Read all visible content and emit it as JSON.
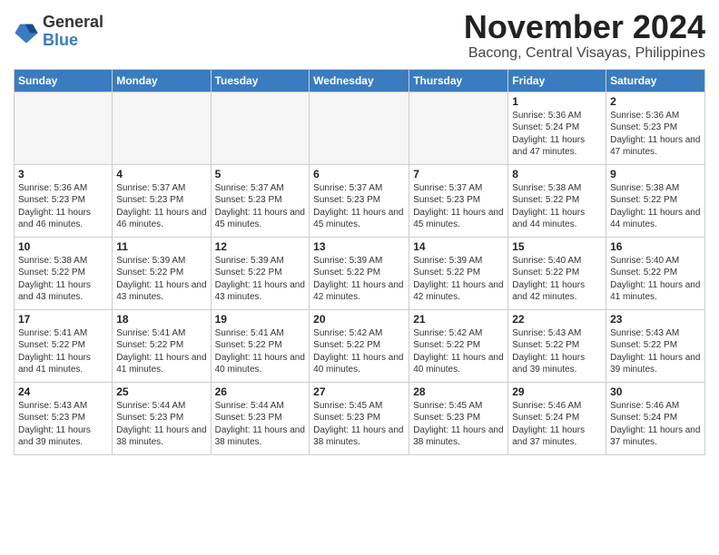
{
  "header": {
    "logo_line1": "General",
    "logo_line2": "Blue",
    "month": "November 2024",
    "location": "Bacong, Central Visayas, Philippines"
  },
  "weekdays": [
    "Sunday",
    "Monday",
    "Tuesday",
    "Wednesday",
    "Thursday",
    "Friday",
    "Saturday"
  ],
  "weeks": [
    [
      {
        "day": "",
        "info": ""
      },
      {
        "day": "",
        "info": ""
      },
      {
        "day": "",
        "info": ""
      },
      {
        "day": "",
        "info": ""
      },
      {
        "day": "",
        "info": ""
      },
      {
        "day": "1",
        "info": "Sunrise: 5:36 AM\nSunset: 5:24 PM\nDaylight: 11 hours and 47 minutes."
      },
      {
        "day": "2",
        "info": "Sunrise: 5:36 AM\nSunset: 5:23 PM\nDaylight: 11 hours and 47 minutes."
      }
    ],
    [
      {
        "day": "3",
        "info": "Sunrise: 5:36 AM\nSunset: 5:23 PM\nDaylight: 11 hours and 46 minutes."
      },
      {
        "day": "4",
        "info": "Sunrise: 5:37 AM\nSunset: 5:23 PM\nDaylight: 11 hours and 46 minutes."
      },
      {
        "day": "5",
        "info": "Sunrise: 5:37 AM\nSunset: 5:23 PM\nDaylight: 11 hours and 45 minutes."
      },
      {
        "day": "6",
        "info": "Sunrise: 5:37 AM\nSunset: 5:23 PM\nDaylight: 11 hours and 45 minutes."
      },
      {
        "day": "7",
        "info": "Sunrise: 5:37 AM\nSunset: 5:23 PM\nDaylight: 11 hours and 45 minutes."
      },
      {
        "day": "8",
        "info": "Sunrise: 5:38 AM\nSunset: 5:22 PM\nDaylight: 11 hours and 44 minutes."
      },
      {
        "day": "9",
        "info": "Sunrise: 5:38 AM\nSunset: 5:22 PM\nDaylight: 11 hours and 44 minutes."
      }
    ],
    [
      {
        "day": "10",
        "info": "Sunrise: 5:38 AM\nSunset: 5:22 PM\nDaylight: 11 hours and 43 minutes."
      },
      {
        "day": "11",
        "info": "Sunrise: 5:39 AM\nSunset: 5:22 PM\nDaylight: 11 hours and 43 minutes."
      },
      {
        "day": "12",
        "info": "Sunrise: 5:39 AM\nSunset: 5:22 PM\nDaylight: 11 hours and 43 minutes."
      },
      {
        "day": "13",
        "info": "Sunrise: 5:39 AM\nSunset: 5:22 PM\nDaylight: 11 hours and 42 minutes."
      },
      {
        "day": "14",
        "info": "Sunrise: 5:39 AM\nSunset: 5:22 PM\nDaylight: 11 hours and 42 minutes."
      },
      {
        "day": "15",
        "info": "Sunrise: 5:40 AM\nSunset: 5:22 PM\nDaylight: 11 hours and 42 minutes."
      },
      {
        "day": "16",
        "info": "Sunrise: 5:40 AM\nSunset: 5:22 PM\nDaylight: 11 hours and 41 minutes."
      }
    ],
    [
      {
        "day": "17",
        "info": "Sunrise: 5:41 AM\nSunset: 5:22 PM\nDaylight: 11 hours and 41 minutes."
      },
      {
        "day": "18",
        "info": "Sunrise: 5:41 AM\nSunset: 5:22 PM\nDaylight: 11 hours and 41 minutes."
      },
      {
        "day": "19",
        "info": "Sunrise: 5:41 AM\nSunset: 5:22 PM\nDaylight: 11 hours and 40 minutes."
      },
      {
        "day": "20",
        "info": "Sunrise: 5:42 AM\nSunset: 5:22 PM\nDaylight: 11 hours and 40 minutes."
      },
      {
        "day": "21",
        "info": "Sunrise: 5:42 AM\nSunset: 5:22 PM\nDaylight: 11 hours and 40 minutes."
      },
      {
        "day": "22",
        "info": "Sunrise: 5:43 AM\nSunset: 5:22 PM\nDaylight: 11 hours and 39 minutes."
      },
      {
        "day": "23",
        "info": "Sunrise: 5:43 AM\nSunset: 5:22 PM\nDaylight: 11 hours and 39 minutes."
      }
    ],
    [
      {
        "day": "24",
        "info": "Sunrise: 5:43 AM\nSunset: 5:23 PM\nDaylight: 11 hours and 39 minutes."
      },
      {
        "day": "25",
        "info": "Sunrise: 5:44 AM\nSunset: 5:23 PM\nDaylight: 11 hours and 38 minutes."
      },
      {
        "day": "26",
        "info": "Sunrise: 5:44 AM\nSunset: 5:23 PM\nDaylight: 11 hours and 38 minutes."
      },
      {
        "day": "27",
        "info": "Sunrise: 5:45 AM\nSunset: 5:23 PM\nDaylight: 11 hours and 38 minutes."
      },
      {
        "day": "28",
        "info": "Sunrise: 5:45 AM\nSunset: 5:23 PM\nDaylight: 11 hours and 38 minutes."
      },
      {
        "day": "29",
        "info": "Sunrise: 5:46 AM\nSunset: 5:24 PM\nDaylight: 11 hours and 37 minutes."
      },
      {
        "day": "30",
        "info": "Sunrise: 5:46 AM\nSunset: 5:24 PM\nDaylight: 11 hours and 37 minutes."
      }
    ]
  ]
}
